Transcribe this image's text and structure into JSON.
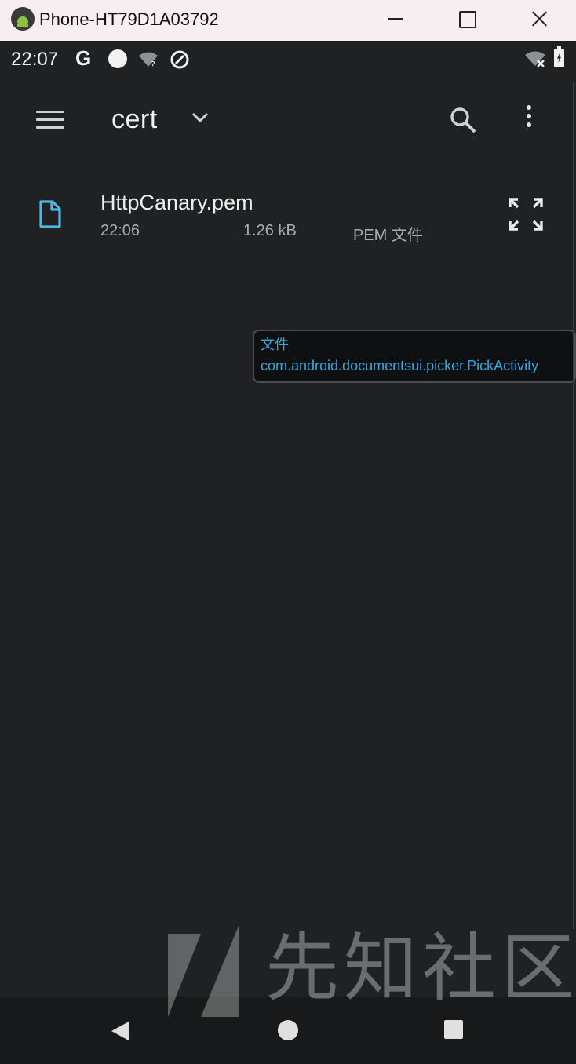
{
  "window": {
    "title": "Phone-HT79D1A03792"
  },
  "status_bar": {
    "time": "22:07",
    "g_label": "G"
  },
  "app_bar": {
    "folder_title": "cert"
  },
  "files": [
    {
      "name": "HttpCanary.pem",
      "date": "22:06",
      "size": "1.26 kB",
      "type": "PEM 文件"
    }
  ],
  "activity_overlay": {
    "line1": "文件",
    "line2": "com.android.documentsui.picker.PickActivity"
  },
  "watermark": {
    "text": "先知社区"
  },
  "colors": {
    "background": "#1f2123",
    "accent_file_icon": "#4fb8e0",
    "overlay_text": "#38a6e0",
    "title_bar": "#f6eef1"
  },
  "icons": [
    "android-app-icon",
    "minimize-icon",
    "maximize-icon",
    "close-icon",
    "circle-notification-icon",
    "wifi-question-icon",
    "at-sign-icon",
    "wifi-off-icon",
    "battery-charging-icon",
    "menu-icon",
    "chevron-down-icon",
    "search-icon",
    "more-vert-icon",
    "file-icon",
    "expand-icon",
    "back-icon",
    "home-icon",
    "recents-icon"
  ]
}
